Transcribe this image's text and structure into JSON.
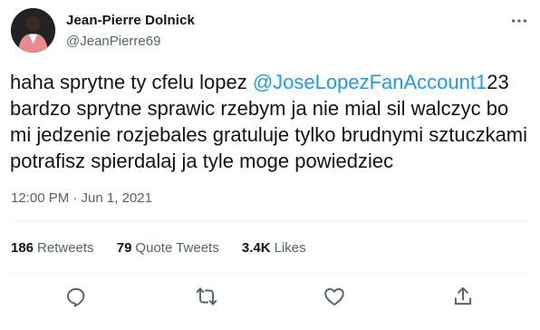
{
  "author": {
    "name": "Jean-Pierre Dolnick",
    "handle": "@JeanPierre69"
  },
  "tweet": {
    "text_before_mention": "haha sprytne ty cfelu lopez ",
    "mention": "@JoseLopezFanAccount1",
    "text_after_mention": "23 bardzo sprytne sprawic rzebym ja nie mial sil walczyc bo mi jedzenie rozjebales gratuluje tylko brudnymi sztuczkami potrafisz spierdalaj ja tyle moge powiedziec",
    "timestamp": "12:00 PM · Jun 1, 2021"
  },
  "stats": {
    "retweets_count": "186",
    "retweets_label": "Retweets",
    "quotes_count": "79",
    "quotes_label": "Quote Tweets",
    "likes_count": "3.4K",
    "likes_label": "Likes"
  },
  "icons": {
    "more": "more-dots-icon",
    "reply": "reply-icon",
    "retweet": "retweet-icon",
    "like": "heart-icon",
    "share": "share-icon"
  },
  "colors": {
    "text": "#0f1419",
    "secondary": "#536471",
    "link": "#1d9bf0",
    "divider": "#eff3f4"
  }
}
